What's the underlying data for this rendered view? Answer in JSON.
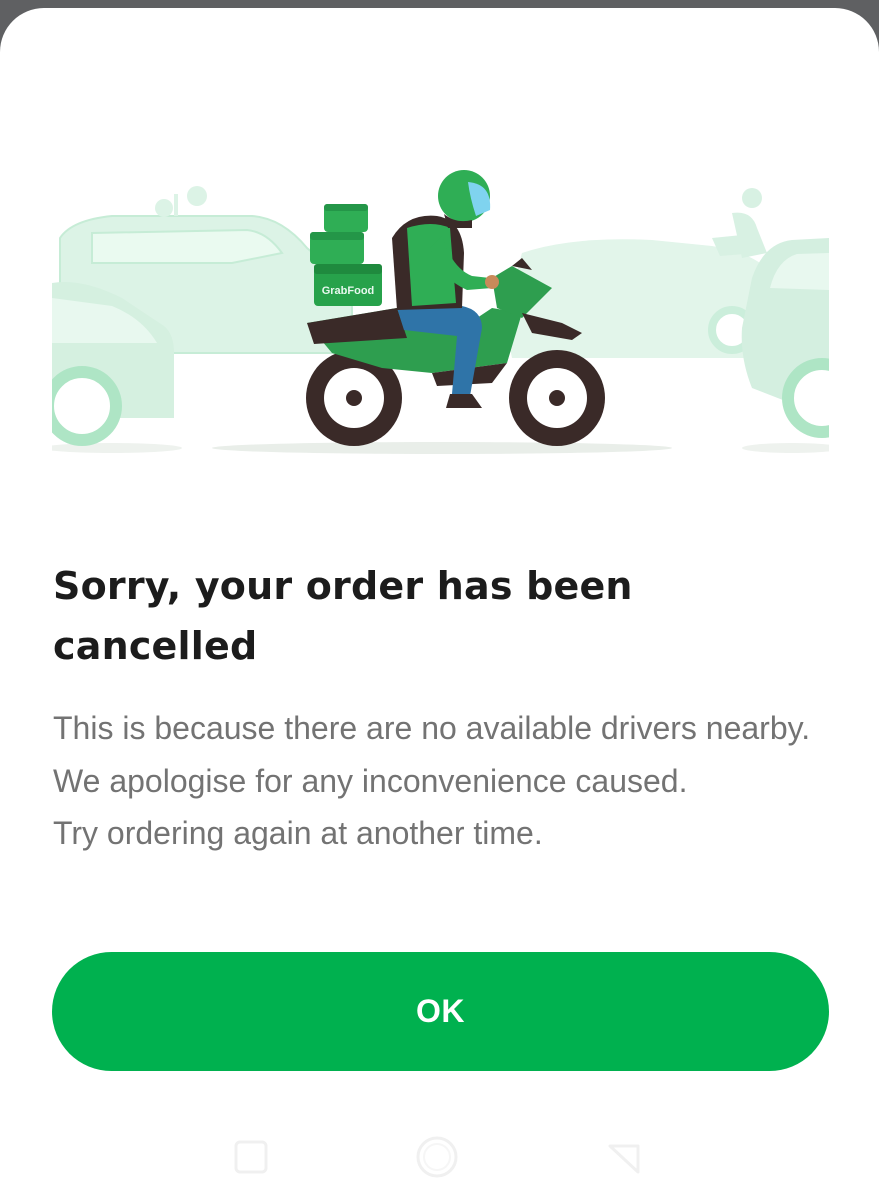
{
  "dialog": {
    "title": "Sorry, your order has been cancelled",
    "message_lines": [
      "This is because there are no available drivers nearby.",
      "We apologise for any inconvenience caused.",
      "Try ordering again at another time."
    ],
    "ok_label": "OK"
  },
  "illustration": {
    "box_label": "GrabFood",
    "scene": "grabfood-delivery-rider-icon"
  },
  "navbar": {
    "recent_icon": "square-recents-icon",
    "home_icon": "circle-home-icon",
    "back_icon": "triangle-back-icon"
  },
  "colors": {
    "brand_green": "#00b14f",
    "title": "#1c1c1c",
    "body_text": "#737373",
    "background": "#ffffff",
    "car_mint": "#d9f2e4"
  }
}
